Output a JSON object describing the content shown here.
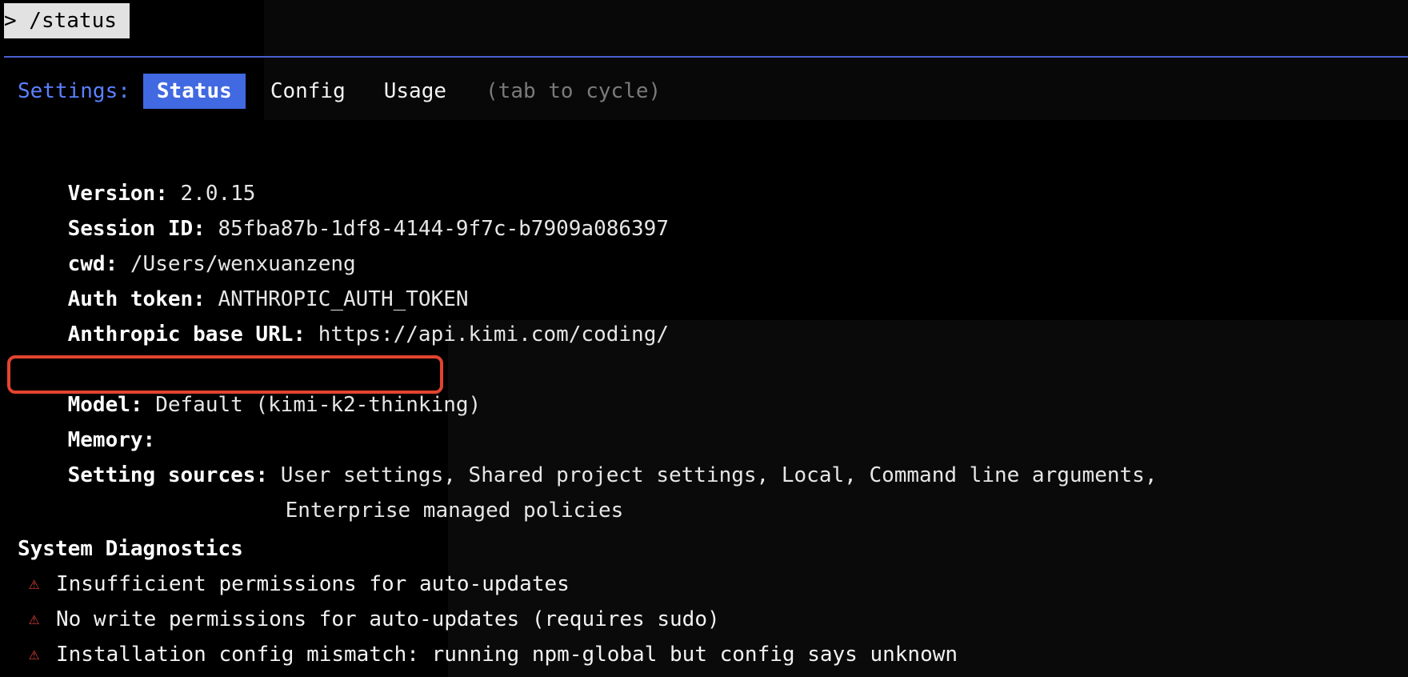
{
  "prompt": {
    "command": "> /status"
  },
  "tabs": {
    "heading": "Settings:",
    "items": [
      {
        "label": "Status",
        "active": true
      },
      {
        "label": "Config",
        "active": false
      },
      {
        "label": "Usage",
        "active": false
      }
    ],
    "hint": "(tab to cycle)"
  },
  "info": {
    "version_key": "Version:",
    "version_val": "2.0.15",
    "session_key": "Session ID:",
    "session_val": "85fba87b-1df8-4144-9f7c-b7909a086397",
    "cwd_key": "cwd:",
    "cwd_val": "/Users/wenxuanzeng",
    "auth_key": "Auth token:",
    "auth_val": "ANTHROPIC_AUTH_TOKEN",
    "baseurl_key": "Anthropic base URL:",
    "baseurl_val": "https://api.kimi.com/coding/",
    "model_key": "Model:",
    "model_val": "Default (kimi-k2-thinking)",
    "memory_key": "Memory:",
    "sources_key": "Setting sources:",
    "sources_val_line1": "User settings, Shared project settings, Local, Command line arguments,",
    "sources_val_line2": "Enterprise managed policies"
  },
  "diagnostics": {
    "title": "System Diagnostics",
    "warning_icon": "warning-triangle-icon",
    "items": [
      "Insufficient permissions for auto-updates",
      "No write permissions for auto-updates (requires sudo)",
      "Installation config mismatch: running npm-global but config says unknown"
    ]
  },
  "colors": {
    "accent": "#4169e1",
    "settings_label": "#5b80ff",
    "highlight_box": "#e2442f",
    "warning": "#e0443a",
    "hint": "#7a7a7a"
  }
}
